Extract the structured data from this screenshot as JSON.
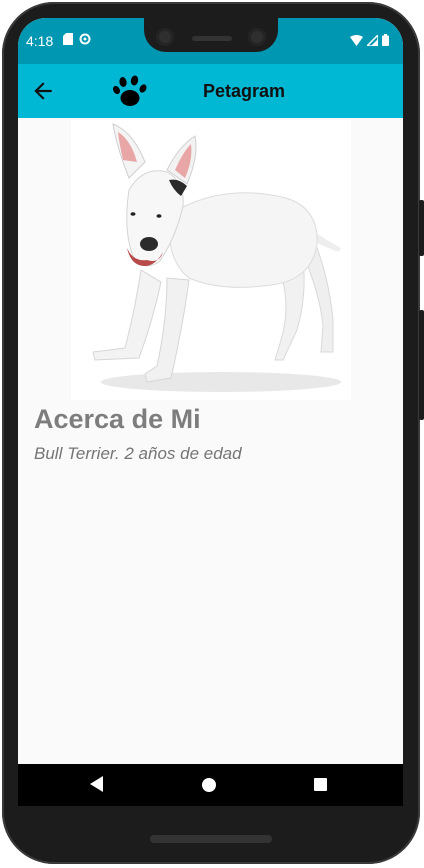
{
  "status_bar": {
    "time": "4:18",
    "icons_left": [
      "sd-card-icon",
      "sync-icon"
    ],
    "icons_right": [
      "wifi-icon",
      "signal-icon",
      "battery-icon"
    ]
  },
  "toolbar": {
    "back_icon": "arrow-back-icon",
    "logo_icon": "paw-icon",
    "title": "Petagram",
    "color": "#00b8d4"
  },
  "profile": {
    "photo_icon": "dog-photo",
    "about_title": "Acerca de Mi",
    "about_description": "Bull Terrier. 2 años de edad"
  },
  "nav_bar": {
    "buttons": [
      "back-triangle-icon",
      "home-circle-icon",
      "recents-square-icon"
    ]
  }
}
